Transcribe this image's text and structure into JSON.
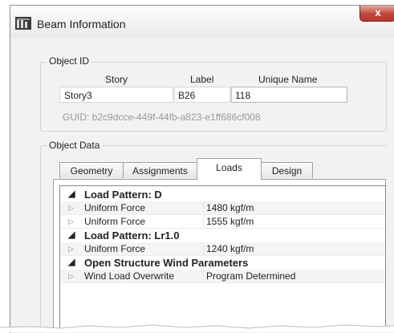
{
  "window": {
    "title": "Beam Information",
    "close_glyph": "x"
  },
  "object_id": {
    "label": "Object ID",
    "headers": {
      "story": "Story",
      "label": "Label",
      "unique_name": "Unique Name"
    },
    "values": {
      "story": "Story3",
      "label": "B26",
      "unique_name": "118"
    },
    "guid": "GUID:  b2c9dcce-449f-44fb-a823-e1ff686cf008"
  },
  "object_data": {
    "label": "Object Data",
    "tabs": [
      {
        "label": "Geometry"
      },
      {
        "label": "Assignments"
      },
      {
        "label": "Loads"
      },
      {
        "label": "Design"
      }
    ],
    "active_tab": "Loads",
    "rows": [
      {
        "expander": "◢",
        "name": "Load Pattern: D",
        "value": "",
        "bold": true
      },
      {
        "expander": "▷",
        "name": "Uniform Force",
        "value": "1480 kgf/m",
        "bold": false
      },
      {
        "expander": "▷",
        "name": "Uniform Force",
        "value": "1555 kgf/m",
        "bold": false
      },
      {
        "expander": "◢",
        "name": "Load Pattern: Lr1.0",
        "value": "",
        "bold": true
      },
      {
        "expander": "▷",
        "name": "Uniform Force",
        "value": "1240 kgf/m",
        "bold": false
      },
      {
        "expander": "◢",
        "name": "Open Structure Wind Parameters",
        "value": "",
        "bold": true
      },
      {
        "expander": "▷",
        "name": "Wind Load Overwrite",
        "value": "Program Determined",
        "bold": false
      }
    ]
  },
  "colors": {
    "close_button": "#c1453a",
    "window_bg": "#f2f2f2",
    "row_alt": "#f4f4f4"
  },
  "icons": [
    "app-icon",
    "close-icon",
    "collapse-triangle-icon",
    "expand-triangle-icon"
  ]
}
